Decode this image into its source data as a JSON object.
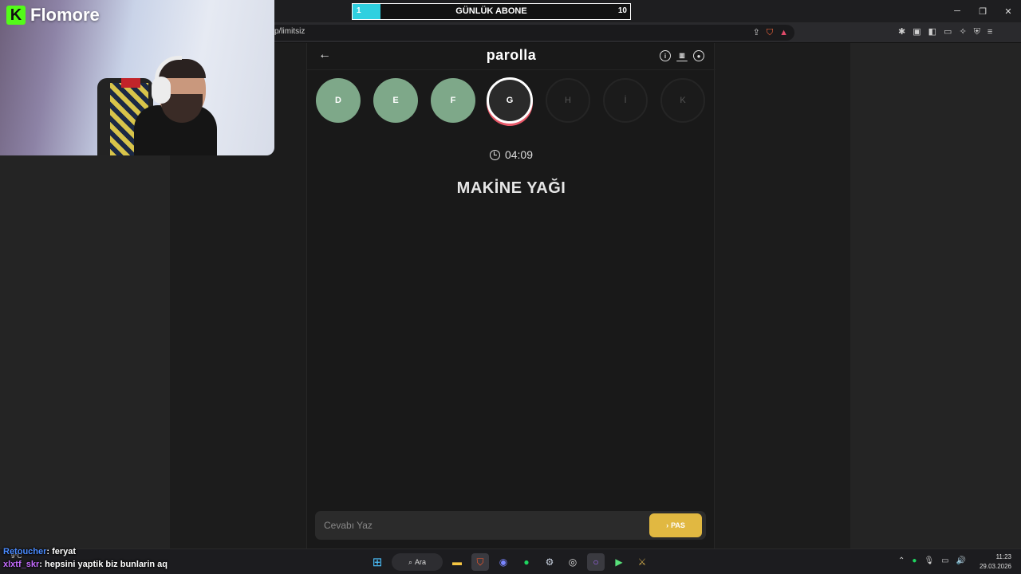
{
  "stream": {
    "brand": "Flomore",
    "brand_logo_letter": "K",
    "sub_goal": {
      "current": "1",
      "title": "GÜNLÜK ABONE",
      "target": "10",
      "progress": 0.1
    }
  },
  "browser": {
    "url": "p/limitsiz"
  },
  "game": {
    "title": "parolla",
    "letters": [
      {
        "label": "D",
        "state": "done"
      },
      {
        "label": "E",
        "state": "done"
      },
      {
        "label": "F",
        "state": "done"
      },
      {
        "label": "G",
        "state": "active"
      },
      {
        "label": "H",
        "state": "pending"
      },
      {
        "label": "İ",
        "state": "pending"
      },
      {
        "label": "K",
        "state": "pending"
      }
    ],
    "timer": "04:09",
    "question": "MAKİNE YAĞI",
    "answer_placeholder": "Cevabı Yaz",
    "pass_label": "PAS"
  },
  "chat": [
    {
      "user": "Retoucher",
      "message": ": feryat"
    },
    {
      "user": "xlxtf_skr",
      "message": ": hepsini yaptik biz bunlarin aq"
    }
  ],
  "taskbar": {
    "weather": "9°C",
    "search_label": "Ara",
    "time": "11:23",
    "date": "29.03.2026"
  },
  "colors": {
    "done": "#7ea889",
    "active_ring": "#e85a6a",
    "pass_button": "#e1b841",
    "sub_fill": "#2fd0e0",
    "kick_green": "#53fc18"
  }
}
